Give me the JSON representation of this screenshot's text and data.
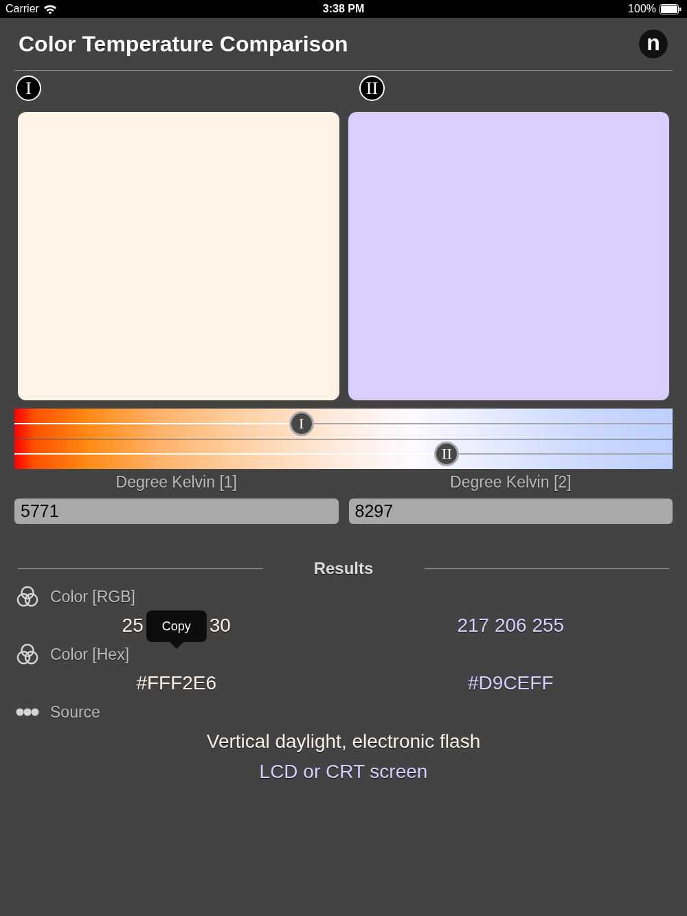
{
  "status_bar": {
    "carrier": "Carrier",
    "time": "3:38 PM",
    "battery": "100%"
  },
  "header": {
    "title": "Color Temperature Comparison",
    "logo_letter": "n"
  },
  "samples": [
    {
      "marker": "I",
      "color": "#fff2e6"
    },
    {
      "marker": "II",
      "color": "#d9ceff"
    }
  ],
  "kelvin_sliders": [
    {
      "marker": "I",
      "level": 0.436
    },
    {
      "marker": "II",
      "level": 0.657
    }
  ],
  "kelvin_fields": [
    {
      "label": "Degree Kelvin [1]",
      "value": "5771"
    },
    {
      "label": "Degree Kelvin [2]",
      "value": "8297"
    }
  ],
  "results": {
    "title": "Results",
    "rows": [
      {
        "kind": "color",
        "label": "Color [RGB]",
        "values": [
          {
            "parts": [
              "25",
              "30"
            ],
            "color": "#fff2e6",
            "popup": "Copy"
          },
          {
            "parts": [
              "217 206 255"
            ],
            "color": "#d9ceff"
          }
        ]
      },
      {
        "kind": "color",
        "label": "Color [Hex]",
        "values": [
          {
            "parts": [
              "#FFF2E6"
            ],
            "color": "#fff2e6"
          },
          {
            "parts": [
              "#D9CEFF"
            ],
            "color": "#d9ceff"
          }
        ]
      },
      {
        "kind": "source",
        "label": "Source",
        "lines": [
          {
            "text": "Vertical daylight, electronic flash",
            "color": "#fff2e6"
          },
          {
            "text": "LCD or CRT screen",
            "color": "#d9ceff"
          }
        ]
      }
    ]
  }
}
